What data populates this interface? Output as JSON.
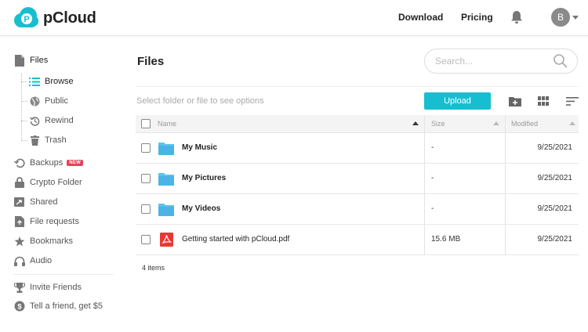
{
  "header": {
    "brand": "pCloud",
    "nav": {
      "download": "Download",
      "pricing": "Pricing"
    },
    "avatar_initial": "B",
    "brand_color": "#17bed0"
  },
  "sidebar": {
    "files": "Files",
    "sub": {
      "browse": "Browse",
      "public": "Public",
      "rewind": "Rewind",
      "trash": "Trash"
    },
    "backups": "Backups",
    "backups_badge": "NEW",
    "crypto": "Crypto Folder",
    "shared": "Shared",
    "file_requests": "File requests",
    "bookmarks": "Bookmarks",
    "audio": "Audio",
    "invite": "Invite Friends",
    "tell": "Tell a friend, get $5"
  },
  "main": {
    "title": "Files",
    "search_placeholder": "Search...",
    "hint": "Select folder or file to see options",
    "upload": "Upload",
    "columns": {
      "name": "Name",
      "size": "Size",
      "modified": "Modified"
    },
    "rows": [
      {
        "name": "My Music",
        "size": "-",
        "modified": "9/25/2021"
      },
      {
        "name": "My Pictures",
        "size": "-",
        "modified": "9/25/2021"
      },
      {
        "name": "My Videos",
        "size": "-",
        "modified": "9/25/2021"
      },
      {
        "name": "Getting started with pCloud.pdf",
        "size": "15.6 MB",
        "modified": "9/25/2021"
      }
    ],
    "count": "4 items"
  },
  "icons": {
    "folder_color": "#5bc2f0",
    "pdf_color": "#e53935",
    "badge_color": "#e2445c"
  }
}
